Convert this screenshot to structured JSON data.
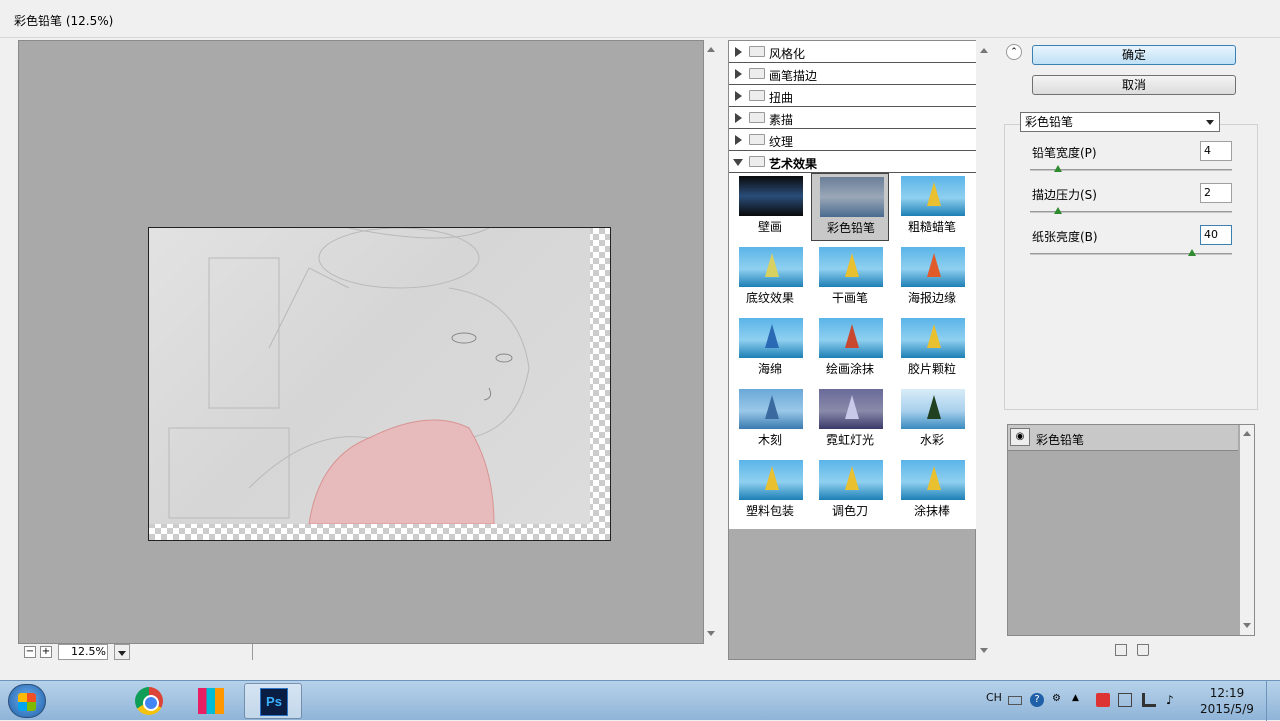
{
  "window": {
    "title": "彩色铅笔 (12.5%)"
  },
  "preview": {
    "zoom_value": "12.5%"
  },
  "categories": [
    {
      "label": "风格化"
    },
    {
      "label": "画笔描边"
    },
    {
      "label": "扭曲"
    },
    {
      "label": "素描"
    },
    {
      "label": "纹理"
    },
    {
      "label": "艺术效果"
    }
  ],
  "filters": [
    {
      "label": "壁画"
    },
    {
      "label": "彩色铅笔"
    },
    {
      "label": "粗糙蜡笔"
    },
    {
      "label": "底纹效果"
    },
    {
      "label": "干画笔"
    },
    {
      "label": "海报边缘"
    },
    {
      "label": "海绵"
    },
    {
      "label": "绘画涂抹"
    },
    {
      "label": "胶片颗粒"
    },
    {
      "label": "木刻"
    },
    {
      "label": "霓虹灯光"
    },
    {
      "label": "水彩"
    },
    {
      "label": "塑料包装"
    },
    {
      "label": "调色刀"
    },
    {
      "label": "涂抹棒"
    }
  ],
  "buttons": {
    "ok": "确定",
    "cancel": "取消"
  },
  "settings": {
    "selected_filter": "彩色铅笔",
    "params": [
      {
        "label": "铅笔宽度(P)",
        "value": "4",
        "fraction": 0.14
      },
      {
        "label": "描边压力(S)",
        "value": "2",
        "fraction": 0.14
      },
      {
        "label": "纸张亮度(B)",
        "value": "40",
        "fraction": 0.8
      }
    ]
  },
  "layers": {
    "item": "彩色铅笔"
  },
  "taskbar": {
    "ps_label": "Ps",
    "input_lang": "CH",
    "time": "12:19",
    "date": "2015/5/9"
  },
  "colors": {
    "preview_bg": "#a9a9a9",
    "taskbar": "#a7c6e4",
    "ok_border": "#3c7fb1"
  }
}
